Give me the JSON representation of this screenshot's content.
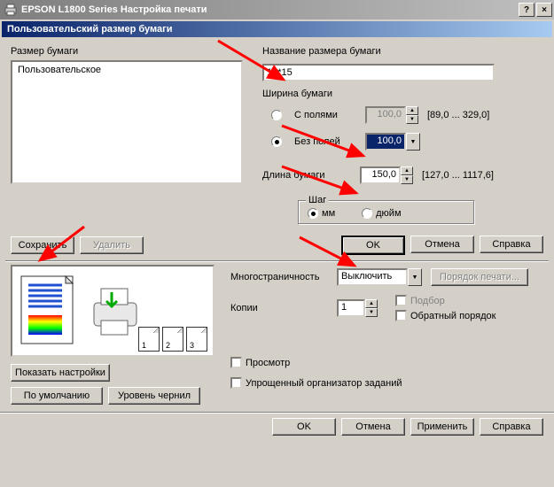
{
  "titlebar": {
    "icon": "printer-icon",
    "text": "EPSON L1800 Series Настройка печати",
    "help": "?",
    "close": "×"
  },
  "section_title": "Пользовательский размер бумаги",
  "paper_size": {
    "label": "Размер бумаги",
    "items": [
      "Пользовательское"
    ]
  },
  "size_name": {
    "label": "Название размера бумаги",
    "value": "10*15"
  },
  "width": {
    "label": "Ширина бумаги",
    "with_margins": {
      "label": "С полями",
      "value": "100,0",
      "range": "[89,0 ... 329,0]"
    },
    "borderless": {
      "label": "Без полей",
      "value": "100,0"
    }
  },
  "length": {
    "label": "Длина бумаги",
    "value": "150,0",
    "range": "[127,0 ... 1117,6]"
  },
  "unit": {
    "label": "Шаг",
    "mm": "мм",
    "inch": "дюйм"
  },
  "upper_btns": {
    "save": "Сохранить",
    "delete": "Удалить",
    "ok": "OK",
    "cancel": "Отмена",
    "help": "Справка"
  },
  "lower": {
    "multipage": {
      "label": "Многостраничность",
      "value": "Выключить",
      "page_order": "Порядок печати..."
    },
    "copies": {
      "label": "Копии",
      "value": "1",
      "collate": "Подбор",
      "reverse": "Обратный порядок"
    },
    "show_settings": "Показать настройки",
    "defaults": "По умолчанию",
    "ink_levels": "Уровень чернил",
    "preview": "Просмотр",
    "simple_org": "Упрощенный организатор заданий"
  },
  "bottom": {
    "ok": "OK",
    "cancel": "Отмена",
    "apply": "Применить",
    "help": "Справка"
  }
}
